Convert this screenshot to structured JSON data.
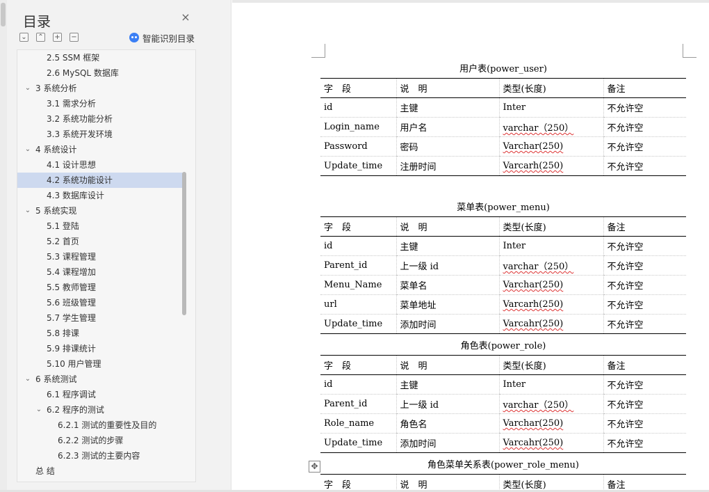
{
  "toc": {
    "title": "目录",
    "smart_toc_label": "智能识别目录",
    "items": [
      {
        "label": "2.5 SSM 框架",
        "level": 2,
        "chevron": ""
      },
      {
        "label": "2.6 MySQL 数据库",
        "level": 2,
        "chevron": ""
      },
      {
        "label": "3 系统分析",
        "level": 1,
        "chevron": "v"
      },
      {
        "label": "3.1 需求分析",
        "level": 2,
        "chevron": ""
      },
      {
        "label": "3.2 系统功能分析",
        "level": 2,
        "chevron": ""
      },
      {
        "label": "3.3 系统开发环境",
        "level": 2,
        "chevron": ""
      },
      {
        "label": "4 系统设计",
        "level": 1,
        "chevron": "v"
      },
      {
        "label": "4.1 设计思想",
        "level": 2,
        "chevron": ""
      },
      {
        "label": "4.2 系统功能设计",
        "level": 2,
        "chevron": "",
        "active": true
      },
      {
        "label": "4.3 数据库设计",
        "level": 2,
        "chevron": ""
      },
      {
        "label": "5 系统实现",
        "level": 1,
        "chevron": "v"
      },
      {
        "label": "5.1 登陆",
        "level": 2,
        "chevron": ""
      },
      {
        "label": "5.2 首页",
        "level": 2,
        "chevron": ""
      },
      {
        "label": "5.3 课程管理",
        "level": 2,
        "chevron": ""
      },
      {
        "label": "5.4 课程增加",
        "level": 2,
        "chevron": ""
      },
      {
        "label": "5.5 教师管理",
        "level": 2,
        "chevron": ""
      },
      {
        "label": "5.6 班级管理",
        "level": 2,
        "chevron": ""
      },
      {
        "label": "5.7 学生管理",
        "level": 2,
        "chevron": ""
      },
      {
        "label": "5.8 排课",
        "level": 2,
        "chevron": ""
      },
      {
        "label": "5.9 排课统计",
        "level": 2,
        "chevron": ""
      },
      {
        "label": "5.10 用户管理",
        "level": 2,
        "chevron": ""
      },
      {
        "label": "6 系统测试",
        "level": 1,
        "chevron": "v"
      },
      {
        "label": "6.1  程序调试",
        "level": 2,
        "chevron": ""
      },
      {
        "label": "6.2  程序的测试",
        "level": 2,
        "chevron": "v"
      },
      {
        "label": "6.2.1  测试的重要性及目的",
        "level": 3,
        "chevron": ""
      },
      {
        "label": "6.2.2  测试的步骤",
        "level": 3,
        "chevron": ""
      },
      {
        "label": "6.2.3  测试的主要内容",
        "level": 3,
        "chevron": ""
      },
      {
        "label": "总  结",
        "level": 1,
        "chevron": ""
      }
    ]
  },
  "icons": {
    "close": "close-icon",
    "collapse_all": "collapse-all-icon",
    "expand_all": "expand-all-icon",
    "add": "add-heading-icon",
    "remove": "remove-heading-icon",
    "smart": "smart-bot-icon",
    "move": "table-move-handle-icon"
  },
  "colors": {
    "panel_bg": "#f2f2f2",
    "active_item": "#cdd9ef",
    "smart_icon": "#3b7ff5",
    "spell_squiggle": "#d33"
  },
  "doc": {
    "header": [
      "字　段",
      "说　明",
      "类型(长度)",
      "备注"
    ],
    "tables": [
      {
        "caption": "用户表(power_user)",
        "rows": [
          [
            "id",
            "主键",
            "Inter",
            "不允许空"
          ],
          [
            "Login_name",
            "用户名",
            "varchar（250）",
            "不允许空"
          ],
          [
            "Password",
            "密码",
            "Varchar(250)",
            "不允许空"
          ],
          [
            "Update_time",
            "注册时间",
            "Varcarh(250)",
            "不允许空"
          ]
        ]
      },
      {
        "caption": "菜单表(power_menu)",
        "rows": [
          [
            "id",
            "主键",
            "Inter",
            "不允许空"
          ],
          [
            "Parent_id",
            "上一级 id",
            "varchar（250）",
            "不允许空"
          ],
          [
            "Menu_Name",
            "菜单名",
            "Varchar(250)",
            "不允许空"
          ],
          [
            "url",
            "菜单地址",
            "Varcarh(250)",
            "不允许空"
          ],
          [
            "Update_time",
            "添加时间",
            "Varcahr(250)",
            "不允许空"
          ]
        ]
      },
      {
        "caption": "角色表(power_role)",
        "rows": [
          [
            "id",
            "主键",
            "Inter",
            "不允许空"
          ],
          [
            "Parent_id",
            "上一级 id",
            "varchar（250）",
            "不允许空"
          ],
          [
            "Role_name",
            "角色名",
            "Varchar(250)",
            "不允许空"
          ],
          [
            "Update_time",
            "添加时间",
            "Varcahr(250)",
            "不允许空"
          ]
        ]
      },
      {
        "caption": "角色菜单关系表(power_role_menu)",
        "rows": []
      }
    ]
  }
}
